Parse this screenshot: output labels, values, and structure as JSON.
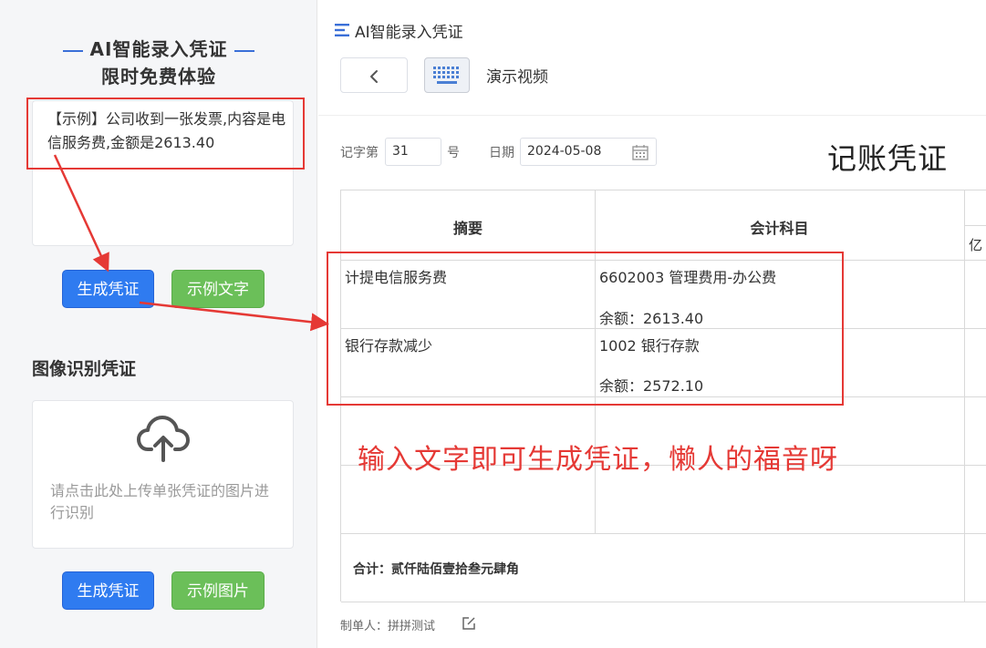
{
  "left_panel": {
    "promo_title": "AI智能录入凭证",
    "promo_subtitle": "限时免费体验",
    "example_text": "【示例】公司收到一张发票,内容是电信服务费,金额是2613.40",
    "generate_label": "生成凭证",
    "example_text_label": "示例文字",
    "image_section_title": "图像识别凭证",
    "upload_hint": "请点击此处上传单张凭证的图片进行识别",
    "example_image_label": "示例图片",
    "icons": {
      "upload": "cloud-upload-icon"
    }
  },
  "header": {
    "title": "AI智能录入凭证",
    "demo_video": "演示视频",
    "icons": {
      "menu": "menu-icon",
      "back": "chevron-left-icon",
      "keyboard": "keyboard-icon"
    }
  },
  "voucher": {
    "number_label": "记字第",
    "number_value": "31",
    "number_suffix": "号",
    "date_label": "日期",
    "date_value": "2024-05-08",
    "title": "记账凭证",
    "table": {
      "col_summary": "摘要",
      "col_account": "会计科目",
      "col_unit": "亿",
      "rows": [
        {
          "summary": "计提电信服务费",
          "account": "6602003 管理费用-办公费",
          "balance": "余额：2613.40"
        },
        {
          "summary": "银行存款减少",
          "account": "1002 银行存款",
          "balance": "余额：2572.10"
        }
      ],
      "total": "合计：贰仟陆佰壹拾叁元肆角"
    },
    "creator": "制单人：拼拼测试"
  },
  "annotation": {
    "text": "输入文字即可生成凭证，懒人的福音呀",
    "color": "#e53935"
  },
  "colors": {
    "primary": "#2f7bf0",
    "success": "#6bbf59",
    "annotation": "#e53935"
  }
}
